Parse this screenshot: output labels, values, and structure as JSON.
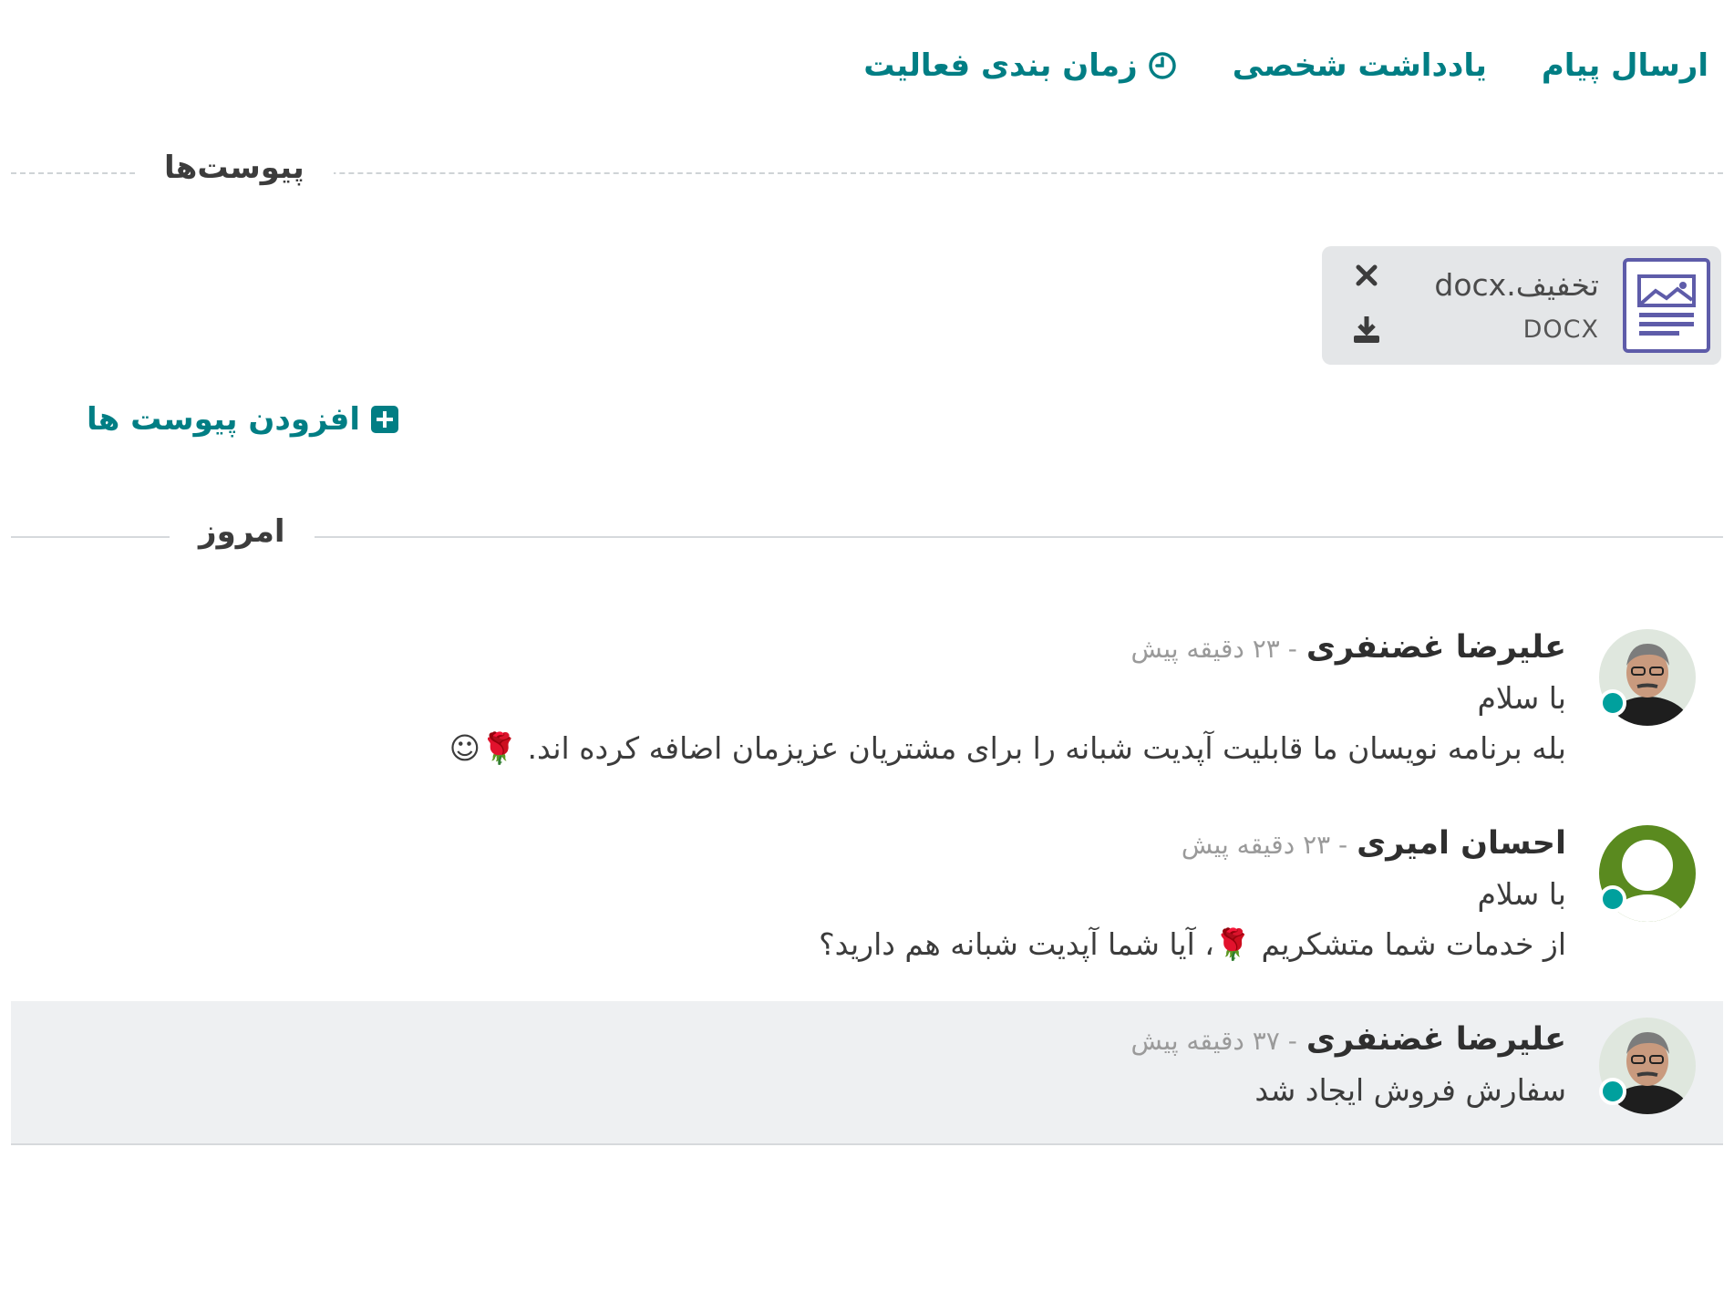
{
  "topbar": {
    "send_message": "ارسال پیام",
    "log_note": "یادداشت شخصی",
    "schedule_activity": "زمان بندی فعالیت"
  },
  "attachments_section": {
    "label": "پیوست‌ها",
    "files": [
      {
        "name": "تخفیف.docx",
        "type": "DOCX"
      }
    ],
    "add_label": "افزودن پیوست ها"
  },
  "today_label": "امروز",
  "messages": [
    {
      "author": "علیرضا غضنفری",
      "time": "- ۲۳ دقیقه پیش",
      "lines": [
        "با سلام",
        "بله برنامه نویسان ما قابلیت آپدیت شبانه را برای مشتریان عزیزمان اضافه کرده اند. 🌹☺"
      ],
      "avatar": "photo",
      "online": true
    },
    {
      "author": "احسان امیری",
      "time": "- ۲۳ دقیقه پیش",
      "lines": [
        "با سلام",
        "از خدمات شما متشکریم 🌹، آیا شما آپدیت شبانه هم دارید؟"
      ],
      "avatar": "placeholder",
      "online": true
    },
    {
      "author": "علیرضا غضنفری",
      "time": "- ۳۷ دقیقه پیش",
      "lines": [
        "سفارش فروش ایجاد شد"
      ],
      "avatar": "photo",
      "online": true
    }
  ],
  "colors": {
    "accent": "#017e84",
    "presence": "#00a09d",
    "file_icon": "#5e5ca9",
    "placeholder_avatar": "#5a8a1f"
  }
}
